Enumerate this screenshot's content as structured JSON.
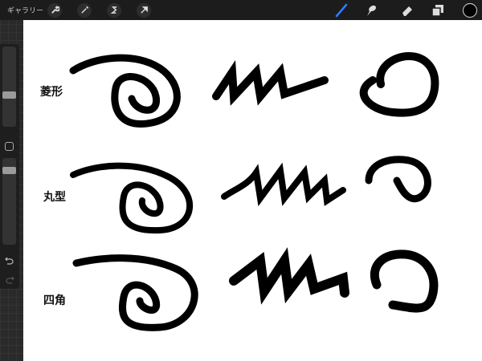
{
  "topbar": {
    "gallery_label": "ギャラリー",
    "left_tools": [
      "wrench-icon",
      "magic-wand-icon",
      "selection-icon",
      "transform-arrow-icon"
    ],
    "right_tools": [
      "brush-icon",
      "smudge-icon",
      "eraser-icon",
      "layers-icon",
      "color-icon"
    ],
    "active_tool_color": "#2f7cf6",
    "current_color": "#000000"
  },
  "sidebar": {
    "brush_size": 0.42,
    "opacity": 0.9,
    "modify_button": "square-icon",
    "undo": "undo-icon",
    "redo": "redo-icon"
  },
  "canvas": {
    "labels": [
      "菱形",
      "丸型",
      "四角"
    ]
  }
}
